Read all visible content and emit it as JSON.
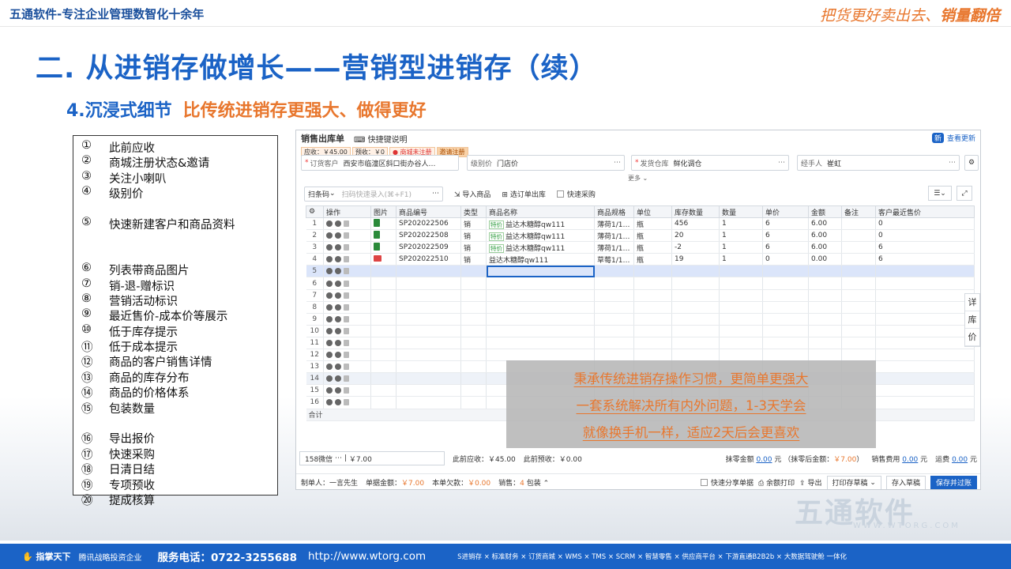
{
  "header": {
    "left": "五通软件-专注企业管理数智化十余年",
    "right_a": "把货更好卖出去、",
    "right_b": "销量翻倍"
  },
  "title": "二. 从进销存做增长——营销型进销存（续）",
  "subtitle": {
    "a": "4.沉浸式细节",
    "b": "比传统进销存更强大、做得更好"
  },
  "features": [
    {
      "n": "①",
      "t": "此前应收"
    },
    {
      "n": "②",
      "t": "商城注册状态&邀请"
    },
    {
      "n": "③",
      "t": "关注小喇叭"
    },
    {
      "n": "④",
      "t": "级别价"
    },
    {
      "n": "⑤",
      "t": "快速新建客户和商品资料"
    },
    {
      "n": "⑥",
      "t": "列表带商品图片"
    },
    {
      "n": "⑦",
      "t": "销-退-赠标识"
    },
    {
      "n": "⑧",
      "t": "营销活动标识"
    },
    {
      "n": "⑨",
      "t": "最近售价-成本价等展示"
    },
    {
      "n": "⑩",
      "t": "低于库存提示"
    },
    {
      "n": "⑪",
      "t": "低于成本提示"
    },
    {
      "n": "⑫",
      "t": "商品的客户销售详情"
    },
    {
      "n": "⑬",
      "t": "商品的库存分布"
    },
    {
      "n": "⑭",
      "t": "商品的价格体系"
    },
    {
      "n": "⑮",
      "t": "包装数量"
    },
    {
      "n": "⑯",
      "t": "导出报价"
    },
    {
      "n": "⑰",
      "t": "快速采购"
    },
    {
      "n": "⑱",
      "t": "日清日结"
    },
    {
      "n": "⑲",
      "t": "专项预收"
    },
    {
      "n": "⑳",
      "t": "提成核算"
    }
  ],
  "app": {
    "title": "销售出库单",
    "help": "快捷键说明",
    "new_badge": "新",
    "new_link": "查看更新",
    "chips": [
      "应收：￥45.00",
      "预收：￥0",
      "商城未注册",
      "邀请注册"
    ],
    "fields": {
      "customer_label": "订货客户",
      "customer_value": "西安市临潼区斜口街办谷人…",
      "level_label": "级别价",
      "level_value": "门店价",
      "warehouse_label": "发货仓库",
      "warehouse_value": "鲜化调仓",
      "handler_label": "经手人",
      "handler_value": "崔虹"
    },
    "more": "更多",
    "toolbar": {
      "scan": "扫条码",
      "scan_ph": "扫码快速录入(⌘+F1)",
      "import": "导入商品",
      "select_order": "选订单出库",
      "quick_buy": "快速采购"
    },
    "columns": [
      "操作",
      "图片",
      "商品编号",
      "类型",
      "商品名称",
      "商品规格",
      "单位",
      "库存数量",
      "数量",
      "单价",
      "金额",
      "备注",
      "客户最近售价"
    ],
    "rows": [
      {
        "id": "SP202022506",
        "type": "销",
        "tag": "特价",
        "name": "益达木糖醇qw111",
        "spec": "薄荷1/1…",
        "unit": "瓶",
        "stock": "456",
        "qty": "1",
        "price": "6",
        "amt": "6.00",
        "recent": "0"
      },
      {
        "id": "SP202022508",
        "type": "销",
        "tag": "特价",
        "name": "益达木糖醇qw111",
        "spec": "薄荷1/1…",
        "unit": "瓶",
        "stock": "20",
        "qty": "1",
        "price": "6",
        "amt": "6.00",
        "recent": "0"
      },
      {
        "id": "SP202022509",
        "type": "销",
        "tag": "特价",
        "name": "益达木糖醇qw111",
        "spec": "薄荷1/1…",
        "unit": "瓶",
        "stock": "-2",
        "qty": "1",
        "price": "6",
        "amt": "6.00",
        "recent": "6"
      },
      {
        "id": "SP202022510",
        "type": "销",
        "tag": "",
        "name": "益达木糖醇qw111",
        "spec": "草莓1/1…",
        "unit": "瓶",
        "stock": "19",
        "qty": "1",
        "price": "0",
        "amt": "0.00",
        "recent": "6"
      }
    ],
    "row_numbers": [
      "1",
      "2",
      "3",
      "4",
      "5",
      "6",
      "7",
      "8",
      "9",
      "10",
      "11",
      "12",
      "13",
      "14",
      "15",
      "16"
    ],
    "total_label": "合计",
    "overlay": [
      "秉承传统进销存操作习惯，更简单更强大",
      "一套系统解决所有内外问题，1-3天学会",
      "就像换手机一样，适应2天后会更喜欢"
    ],
    "side_tabs": [
      "详",
      "库",
      "价"
    ],
    "footer1": {
      "wechat": "158微信",
      "wechat_val": "￥7.00",
      "prev_recv": "此前应收：￥45.00",
      "prev_pre": "此前预收：￥0.00",
      "zero_label": "抹零金额",
      "zero_val": "0.00",
      "zero_unit": "元",
      "after_label": "（抹零后金额：",
      "after_val": "￥7.00",
      "after_end": "）",
      "cost_label": "销售费用",
      "cost_val": "0.00",
      "cost_unit": "元",
      "freight_label": "运费",
      "freight_val": "0.00",
      "freight_unit": "元"
    },
    "footer2": {
      "maker": "制单人：一言先生",
      "order_amt_label": "单据金额：",
      "order_amt": "￥7.00",
      "owe_label": "本单欠款：",
      "owe": "￥0.00",
      "sale_label": "销售：",
      "sale": "4",
      "pack": "包装",
      "quick_share": "快速分享单据",
      "remain_print": "余额打印",
      "export": "导出",
      "print": "打印存草稿",
      "save_draft": "存入草稿",
      "save_post": "保存并过账"
    }
  },
  "watermark": {
    "brand": "五通软件",
    "url": "WWW.WTORG.COM"
  },
  "bottom": {
    "logo": "指掌天下",
    "tencent": "腾讯战略投资企业",
    "service": "服务电话：0722-3255688",
    "url": "http://www.wtorg.com",
    "products": "S进销存 × 标准财务 × 订货商城 × WMS × TMS × SCRM × 智慧零售 × 供应商平台 × 下游直通B2B2b × 大数据驾驶舱 一体化"
  }
}
